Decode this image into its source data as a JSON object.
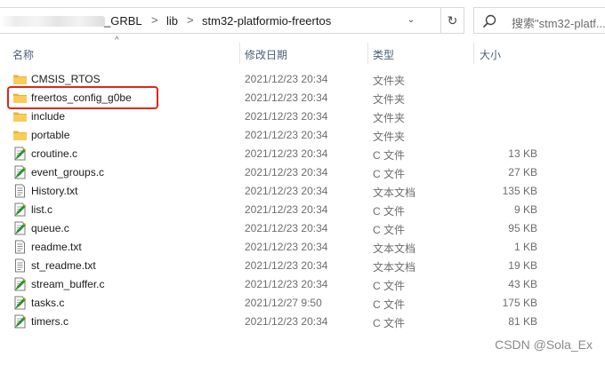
{
  "address_bar": {
    "crumbs": [
      "_GRBL",
      "lib",
      "stm32-platformio-freertos"
    ],
    "separator": ">",
    "dropdown_glyph": "⌄",
    "refresh_glyph": "↻"
  },
  "search": {
    "placeholder": "搜索\"stm32-platf..."
  },
  "columns": {
    "name": "名称",
    "date": "修改日期",
    "type": "类型",
    "size": "大小"
  },
  "files": [
    {
      "name": "CMSIS_RTOS",
      "date": "2021/12/23 20:34",
      "type": "文件夹",
      "size": "",
      "icon": "folder-icon"
    },
    {
      "name": "freertos_config_g0be",
      "date": "2021/12/23 20:34",
      "type": "文件夹",
      "size": "",
      "icon": "folder-icon"
    },
    {
      "name": "include",
      "date": "2021/12/23 20:34",
      "type": "文件夹",
      "size": "",
      "icon": "folder-icon"
    },
    {
      "name": "portable",
      "date": "2021/12/23 20:34",
      "type": "文件夹",
      "size": "",
      "icon": "folder-icon"
    },
    {
      "name": "croutine.c",
      "date": "2021/12/23 20:34",
      "type": "C 文件",
      "size": "13 KB",
      "icon": "c-file-icon"
    },
    {
      "name": "event_groups.c",
      "date": "2021/12/23 20:34",
      "type": "C 文件",
      "size": "27 KB",
      "icon": "c-file-icon"
    },
    {
      "name": "History.txt",
      "date": "2021/12/23 20:34",
      "type": "文本文档",
      "size": "135 KB",
      "icon": "text-file-icon"
    },
    {
      "name": "list.c",
      "date": "2021/12/23 20:34",
      "type": "C 文件",
      "size": "9 KB",
      "icon": "c-file-icon"
    },
    {
      "name": "queue.c",
      "date": "2021/12/23 20:34",
      "type": "C 文件",
      "size": "95 KB",
      "icon": "c-file-icon"
    },
    {
      "name": "readme.txt",
      "date": "2021/12/23 20:34",
      "type": "文本文档",
      "size": "1 KB",
      "icon": "text-file-icon"
    },
    {
      "name": "st_readme.txt",
      "date": "2021/12/23 20:34",
      "type": "文本文档",
      "size": "19 KB",
      "icon": "text-file-icon"
    },
    {
      "name": "stream_buffer.c",
      "date": "2021/12/23 20:34",
      "type": "C 文件",
      "size": "43 KB",
      "icon": "c-file-icon"
    },
    {
      "name": "tasks.c",
      "date": "2021/12/27 9:50",
      "type": "C 文件",
      "size": "175 KB",
      "icon": "c-file-icon"
    },
    {
      "name": "timers.c",
      "date": "2021/12/23 20:34",
      "type": "C 文件",
      "size": "81 KB",
      "icon": "c-file-icon"
    }
  ],
  "highlighted_item": "freertos_config_g0be",
  "watermark": "CSDN @Sola_Ex",
  "colors": {
    "highlight_border": "#e0251b",
    "folder": "#f5c84c",
    "header_text": "#4c607a"
  }
}
